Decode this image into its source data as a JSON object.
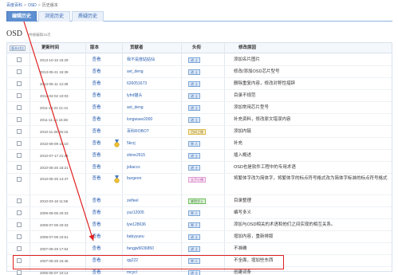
{
  "breadcrumb": {
    "root": "百度百科",
    "item": "OSD",
    "current": "历史版本"
  },
  "tabs": [
    {
      "label": "编辑历史",
      "active": true
    },
    {
      "label": "浏览历史",
      "active": false
    },
    {
      "label": "质疑历史",
      "active": false
    }
  ],
  "page": {
    "title": "OSD",
    "subtitle": "共被编辑15次"
  },
  "table": {
    "compare_label": "版本对比",
    "headers": {
      "time": "更新时间",
      "version": "版本",
      "contributor": "贡献者",
      "title": "头衔",
      "reason": "修改原因"
    },
    "rows": [
      {
        "time": "2013-10-16 15:29",
        "version": "查看",
        "user": "我不是度姑姑仙",
        "badge": "进 士",
        "badge_style": "blue",
        "reason": "添加名片图片",
        "medal": false
      },
      {
        "time": "2013-05-21 15:39",
        "version": "查看",
        "user": "avt_deng",
        "badge": "进 士",
        "badge_style": "blue",
        "reason": "修改/添加OSD芯片型号",
        "medal": false
      },
      {
        "time": "2013-05-11 12:38",
        "version": "查看",
        "user": "626051673",
        "badge": "进 士",
        "badge_style": "blue",
        "reason": "删除重复内容，修改对称性措辞",
        "medal": false
      },
      {
        "time": "2013-02-02 10:03",
        "version": "查看",
        "user": "lyfrd猫头",
        "badge": "进 士",
        "badge_style": "blue",
        "reason": "目录不规范",
        "medal": false
      },
      {
        "time": "2011-12-24 21:41",
        "version": "查看",
        "user": "avt_deng",
        "badge": "进 士",
        "badge_style": "blue",
        "reason": "添加常用芯片型号",
        "medal": false
      },
      {
        "time": "2011-11-21 15:38",
        "version": "查看",
        "user": "longwave2000",
        "badge": "进 士",
        "badge_style": "blue",
        "reason": "补充资料，修改原文错误内容",
        "medal": false
      },
      {
        "time": "2010-11-25 06:15",
        "version": "查看",
        "user": "百科ROBOT",
        "badge": "百科卫视",
        "badge_style": "yellow",
        "reason": "添加内链",
        "medal": false
      },
      {
        "time": "2010-09-09 15:10",
        "version": "查看",
        "user": "5krzj",
        "badge": "举 人",
        "badge_style": "blue",
        "reason": "补充",
        "medal": true
      },
      {
        "time": "2010-07-17 21:38",
        "version": "查看",
        "user": "shine2615",
        "badge": "进 士",
        "badge_style": "blue",
        "reason": "插入概述",
        "medal": false
      },
      {
        "time": "2010-05-26 16:21",
        "version": "查看",
        "user": "jsbaccs",
        "badge": "进 士",
        "badge_style": "blue",
        "reason": "OSD也是软件工程中的专用术语",
        "medal": false
      },
      {
        "time": "2010-05-25 14:47",
        "version": "查看",
        "user": "burgeon",
        "badge": "太子少傅",
        "badge_style": "pink",
        "reason": "将繁体字改为简体字，将繁体字的标点符号格式改为简体字标准的标点符号格式",
        "medal": true,
        "tall": true
      },
      {
        "time": "2010-03-18 11:55",
        "version": "查看",
        "user": "zelfeel",
        "badge": "掌院学士",
        "badge_style": "green",
        "reason": "目录整理",
        "medal": false
      },
      {
        "time": "2009-08-05 20:33",
        "version": "查看",
        "user": "yuz12005",
        "badge": "举 人",
        "badge_style": "blue",
        "reason": "编写多义",
        "medal": false
      },
      {
        "time": "2008-07-09 20:33",
        "version": "查看",
        "user": "lyw128636",
        "badge": "举 人",
        "badge_style": "blue",
        "reason": "添加与OSD相关的术语和他们之间实现的相互关系。",
        "medal": false
      },
      {
        "time": "2008-07-09 10:51",
        "version": "查看",
        "user": "babyyueu",
        "badge": "进 士",
        "badge_style": "blue",
        "reason": "增加内容，重新排版",
        "medal": false
      },
      {
        "time": "2007-09-29 17:54",
        "version": "查看",
        "user": "fangjw5636850",
        "badge": "进 士",
        "badge_style": "blue",
        "reason": "不准确",
        "medal": false
      },
      {
        "time": "2007-09-29 16:45",
        "version": "查看",
        "user": "qq222",
        "badge": "举 人",
        "badge_style": "blue",
        "reason": "不全面，增加些东西",
        "medal": false
      },
      {
        "time": "2006-05-07 10:14",
        "version": "查看",
        "user": "mcycl",
        "badge": "进 士",
        "badge_style": "blue",
        "reason": "创建词条",
        "medal": false
      }
    ]
  },
  "colors": {
    "accent": "#2b5fb0",
    "tab_active": "#5d8fd1",
    "highlight": "#e02020"
  }
}
